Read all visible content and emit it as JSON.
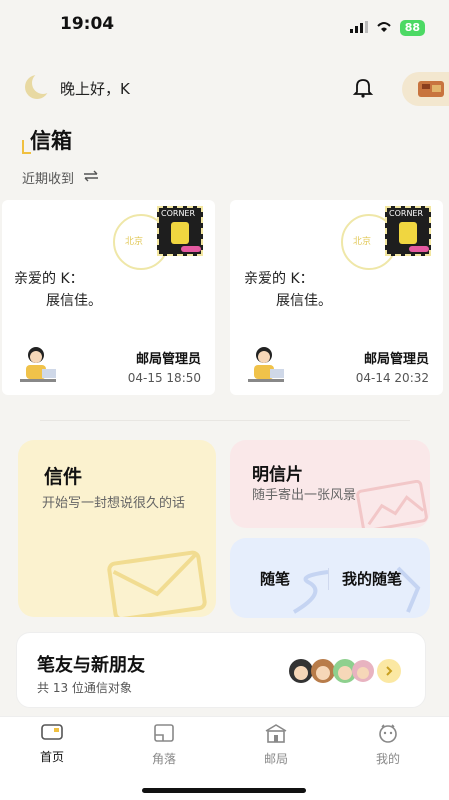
{
  "status_bar": {
    "time": "19:04",
    "battery": "88"
  },
  "header": {
    "greeting": "晚上好，K"
  },
  "mailbox": {
    "title": "信箱",
    "filter_label": "近期收到",
    "letters": [
      {
        "salutation": "亲爱的 K：",
        "body": "展信佳。",
        "sender": "邮局管理员",
        "time": "04-15 18:50",
        "postmark_text": "北京",
        "stamp_text": "CORNER"
      },
      {
        "salutation": "亲爱的 K：",
        "body": "展信佳。",
        "sender": "邮局管理员",
        "time": "04-14 20:32",
        "postmark_text": "北京",
        "stamp_text": "CORNER"
      }
    ]
  },
  "features": {
    "letter": {
      "title": "信件",
      "desc": "开始写一封想说很久的话"
    },
    "postcard": {
      "title": "明信片",
      "desc": "随手寄出一张风景"
    },
    "essay": {
      "title": "随笔",
      "my_title": "我的随笔"
    }
  },
  "penpals": {
    "title": "笔友与新朋友",
    "subtitle": "共 13 位通信对象"
  },
  "tabs": [
    {
      "label": "首页",
      "icon": "home-card-icon",
      "active": true
    },
    {
      "label": "角落",
      "icon": "corner-icon",
      "active": false
    },
    {
      "label": "邮局",
      "icon": "post-office-icon",
      "active": false
    },
    {
      "label": "我的",
      "icon": "profile-icon",
      "active": false
    }
  ],
  "colors": {
    "accent_yellow": "#f0c040",
    "letter_tile": "#fbf2cf",
    "postcard_tile": "#fae8e9",
    "essay_tile": "#e6eefc"
  }
}
